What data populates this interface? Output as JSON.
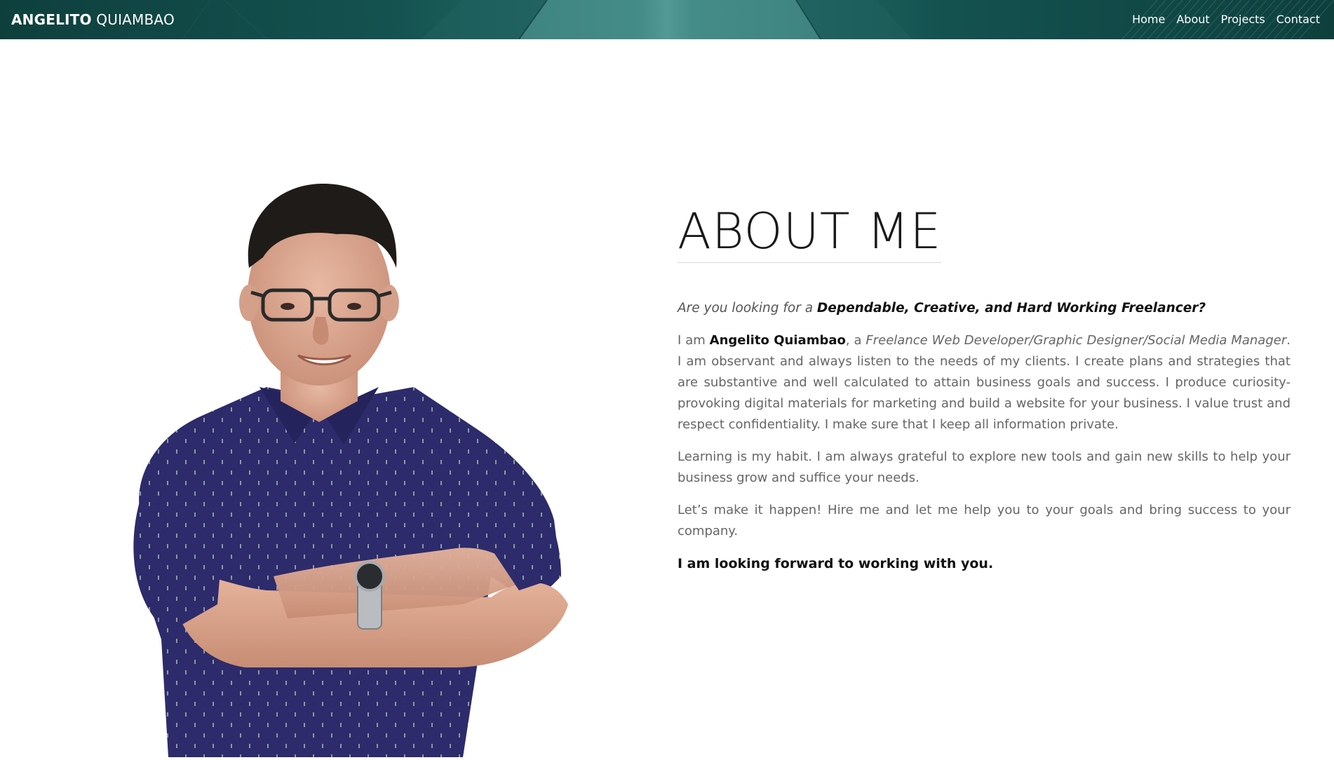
{
  "navbar": {
    "brand_first": "ANGELITO",
    "brand_last": "QUIAMBAO",
    "links": [
      {
        "label": "Home"
      },
      {
        "label": "About"
      },
      {
        "label": "Projects"
      },
      {
        "label": "Contact"
      }
    ],
    "colors": {
      "dark": "#0e3f3d",
      "mid": "#145350",
      "light": "#4b9390"
    }
  },
  "portrait": {
    "icon": "person-photo"
  },
  "about": {
    "title": "ABOUT ME",
    "tagline_prefix": "Are you looking for a",
    "tagline_emphasis": "Dependable, Creative, and Hard Working Freelancer?",
    "intro_prefix": "I am",
    "name": "Angelito Quiambao",
    "intro_sep": ", a",
    "role": "Freelance Web Developer/Graphic Designer/Social Media Manager",
    "intro_rest": ". I am observant and always listen to the needs of my clients. I create plans and strategies that are substantive and well calculated to attain business goals and success. I produce curiosity-provoking digital materials for marketing and build a website for your business. I value trust and respect confidentiality. I make sure that I keep all information private.",
    "para2": "Learning is my habit. I am always grateful to explore new tools and gain new skills to help your business grow and suffice your needs.",
    "para3": "Let’s make it happen! Hire me and let me help you to your goals and bring success to your company.",
    "closing": "I am looking forward to working with you."
  }
}
